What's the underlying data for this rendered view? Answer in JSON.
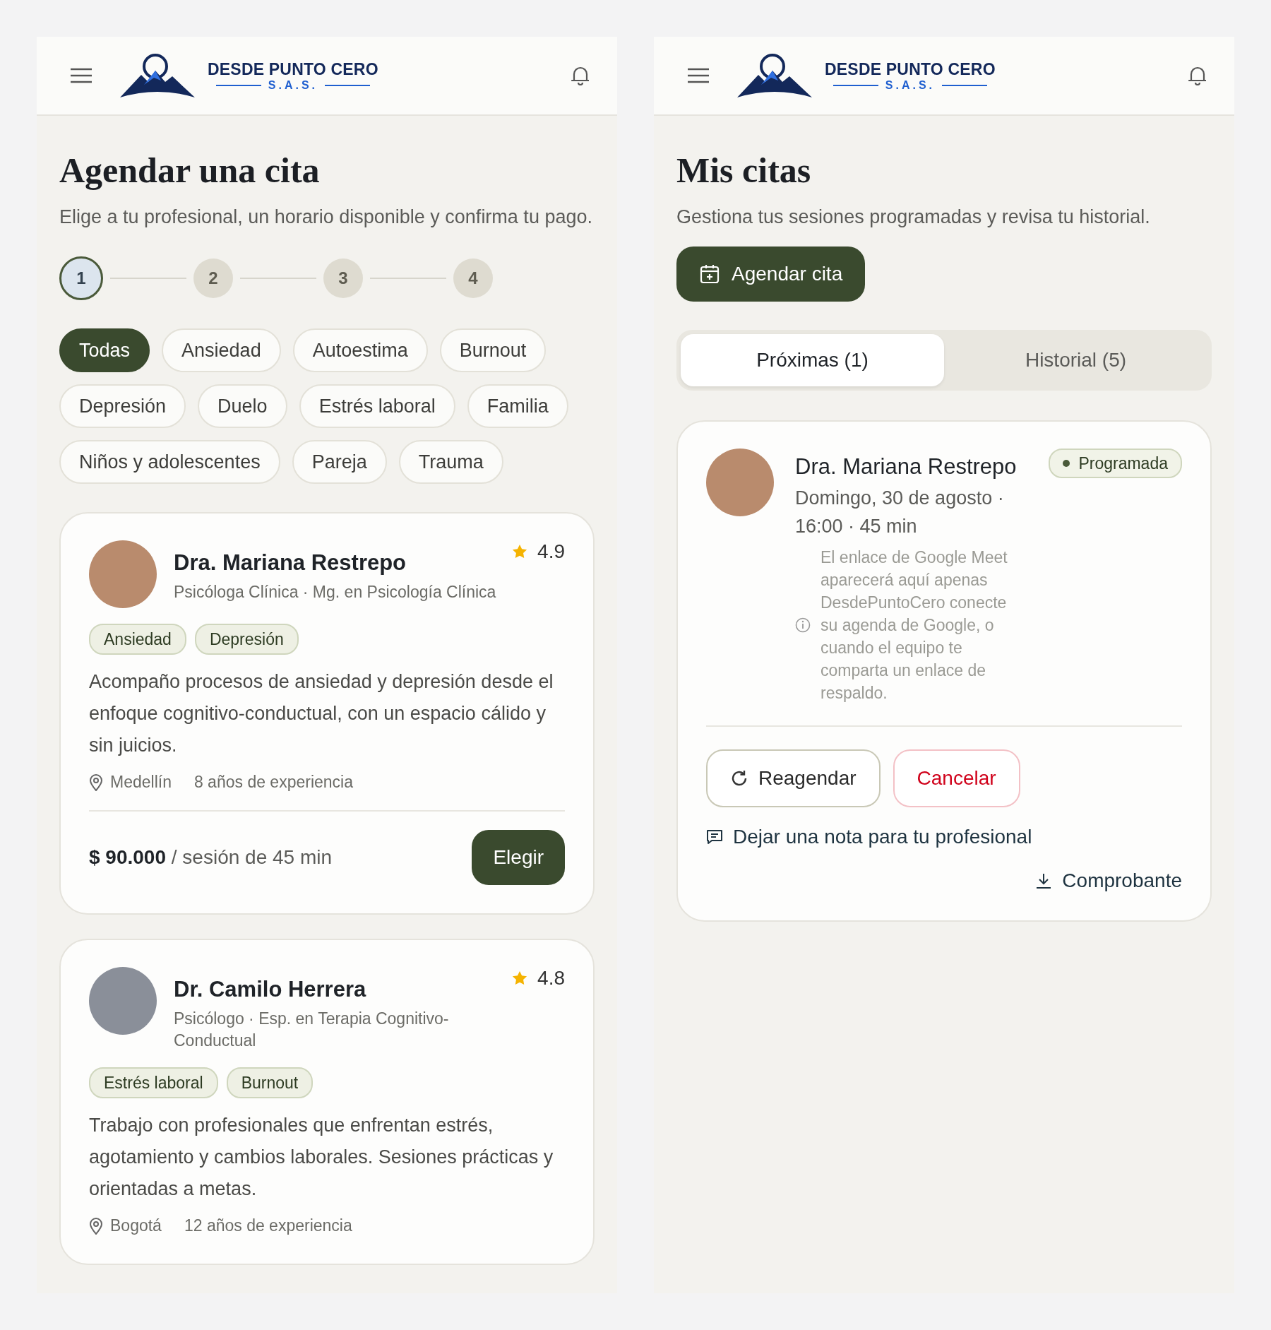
{
  "booking_screen": {
    "header": {
      "brand": "DESDE PUNTO CERO",
      "subbrand": "S.A.S."
    },
    "title": "Agendar una cita",
    "subtitle": "Elige a tu profesional, un horario disponible y confirma tu pago.",
    "steps": [
      {
        "label": "1",
        "selected": true
      },
      {
        "label": "2",
        "selected": false
      },
      {
        "label": "3",
        "selected": false
      },
      {
        "label": "4",
        "selected": false
      }
    ],
    "filters": [
      {
        "label": "Todas",
        "selected": true
      },
      {
        "label": "Ansiedad",
        "selected": false
      },
      {
        "label": "Autoestima",
        "selected": false
      },
      {
        "label": "Burnout",
        "selected": false
      },
      {
        "label": "Depresión",
        "selected": false
      },
      {
        "label": "Duelo",
        "selected": false
      },
      {
        "label": "Estrés laboral",
        "selected": false
      },
      {
        "label": "Familia",
        "selected": false
      },
      {
        "label": "Niños y adolescentes",
        "selected": false
      },
      {
        "label": "Pareja",
        "selected": false
      },
      {
        "label": "Trauma",
        "selected": false
      }
    ],
    "professionals": [
      {
        "name": "Dra. Mariana Restrepo",
        "title": "Psicóloga Clínica · Mg. en Psicología Clínica",
        "rating": "4.9",
        "tags": [
          "Ansiedad",
          "Depresión"
        ],
        "bio": "Acompaño procesos de ansiedad y depresión desde el enfoque cognitivo-conductual, con un espacio cálido y sin juicios.",
        "city": "Medellín",
        "experience": "8 años de experiencia",
        "price": "**$ 90.000** / sesión de 45 min",
        "button": "Elegir"
      },
      {
        "name": "Dr. Camilo Herrera",
        "title": "Psicólogo · Esp. en Terapia Cognitivo-Conductual",
        "rating": "4.8",
        "tags": [
          "Estrés laboral",
          "Burnout"
        ],
        "bio": "Trabajo con profesionales que enfrentan estrés, agotamiento y cambios laborales. Sesiones prácticas y orientadas a metas.",
        "city": "Bogotá",
        "experience": "12 años de experiencia"
      }
    ]
  },
  "appointments_screen": {
    "header": {
      "brand": "DESDE PUNTO CERO",
      "subbrand": "S.A.S."
    },
    "title": "Mis citas",
    "subtitle": "Gestiona tus sesiones programadas y revisa tu historial.",
    "new_button": "Agendar cita",
    "tabs": [
      {
        "label": "Próximas (1)",
        "selected": true
      },
      {
        "label": "Historial (5)",
        "selected": false
      }
    ],
    "appointment": {
      "name": "Dra. Mariana Restrepo",
      "status": "Programada",
      "datetime": "Domingo, 30 de agosto · 16:00 · 45 min",
      "note": "El enlace de Google Meet aparecerá aquí apenas DesdePuntoCero conecte su agenda de Google, o cuando el equipo te comparta un enlace de respaldo.",
      "reschedule": "Reagendar",
      "cancel": "Cancelar",
      "leave_note": "Dejar una nota para tu profesional",
      "receipt": "Comprobante"
    }
  }
}
